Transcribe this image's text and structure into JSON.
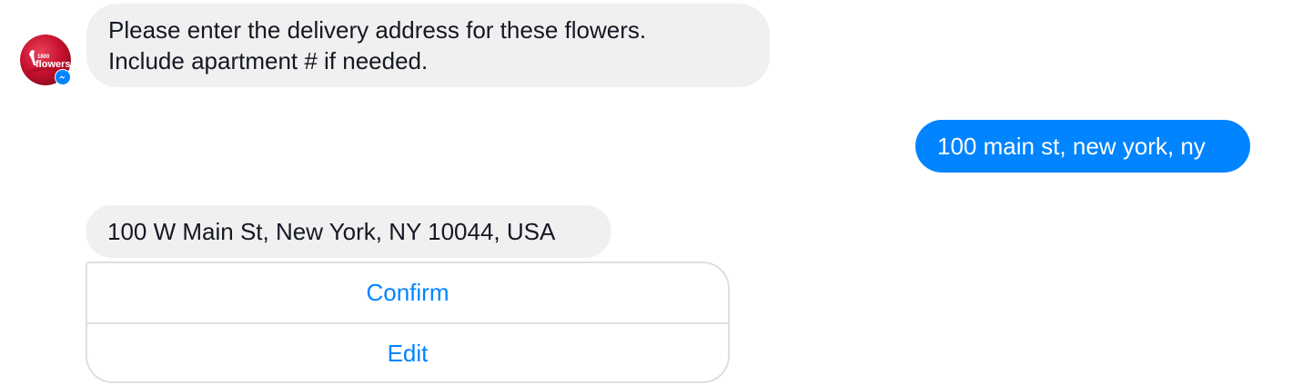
{
  "chat": {
    "bot_avatar": {
      "logo_text_top": "1800",
      "logo_text_main": "flowers",
      "badge_icon": "messenger-icon"
    },
    "messages": [
      {
        "from": "bot",
        "lines": [
          "Please enter the delivery address for these flowers.",
          "Include apartment # if needed."
        ]
      },
      {
        "from": "user",
        "text": "100 main st, new york, ny"
      },
      {
        "from": "bot",
        "text": "100 W Main St, New York, NY 10044, USA"
      }
    ],
    "quick_replies": {
      "confirm_label": "Confirm",
      "edit_label": "Edit"
    }
  },
  "colors": {
    "user_bubble": "#0084ff",
    "bot_bubble": "#f1f0f0",
    "button_text": "#0084ff",
    "avatar_brand": "#c8102e"
  }
}
